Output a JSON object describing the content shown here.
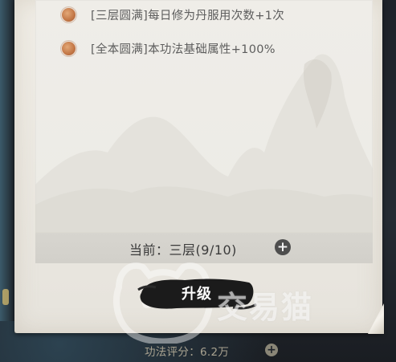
{
  "effects": [
    {
      "text": "[三层圆满]每日修为丹服用次数+1次",
      "bullet_color": "#c57a49"
    },
    {
      "text": "[全本圆满]本功法基础属性+100%",
      "bullet_color": "#c57a49"
    }
  ],
  "level": {
    "text": "当前：三层(9/10)",
    "add_symbol": "+"
  },
  "upgrade": {
    "label": "升级"
  },
  "score": {
    "text": "功法评分：6.2万",
    "add_symbol": "+"
  },
  "watermark": {
    "text": "交易猫"
  },
  "colors": {
    "paper": "#ebe8e1",
    "bullet": "#c57a49",
    "ink_button": "#1a1a1a",
    "level_bar": "#d4d2cc"
  }
}
